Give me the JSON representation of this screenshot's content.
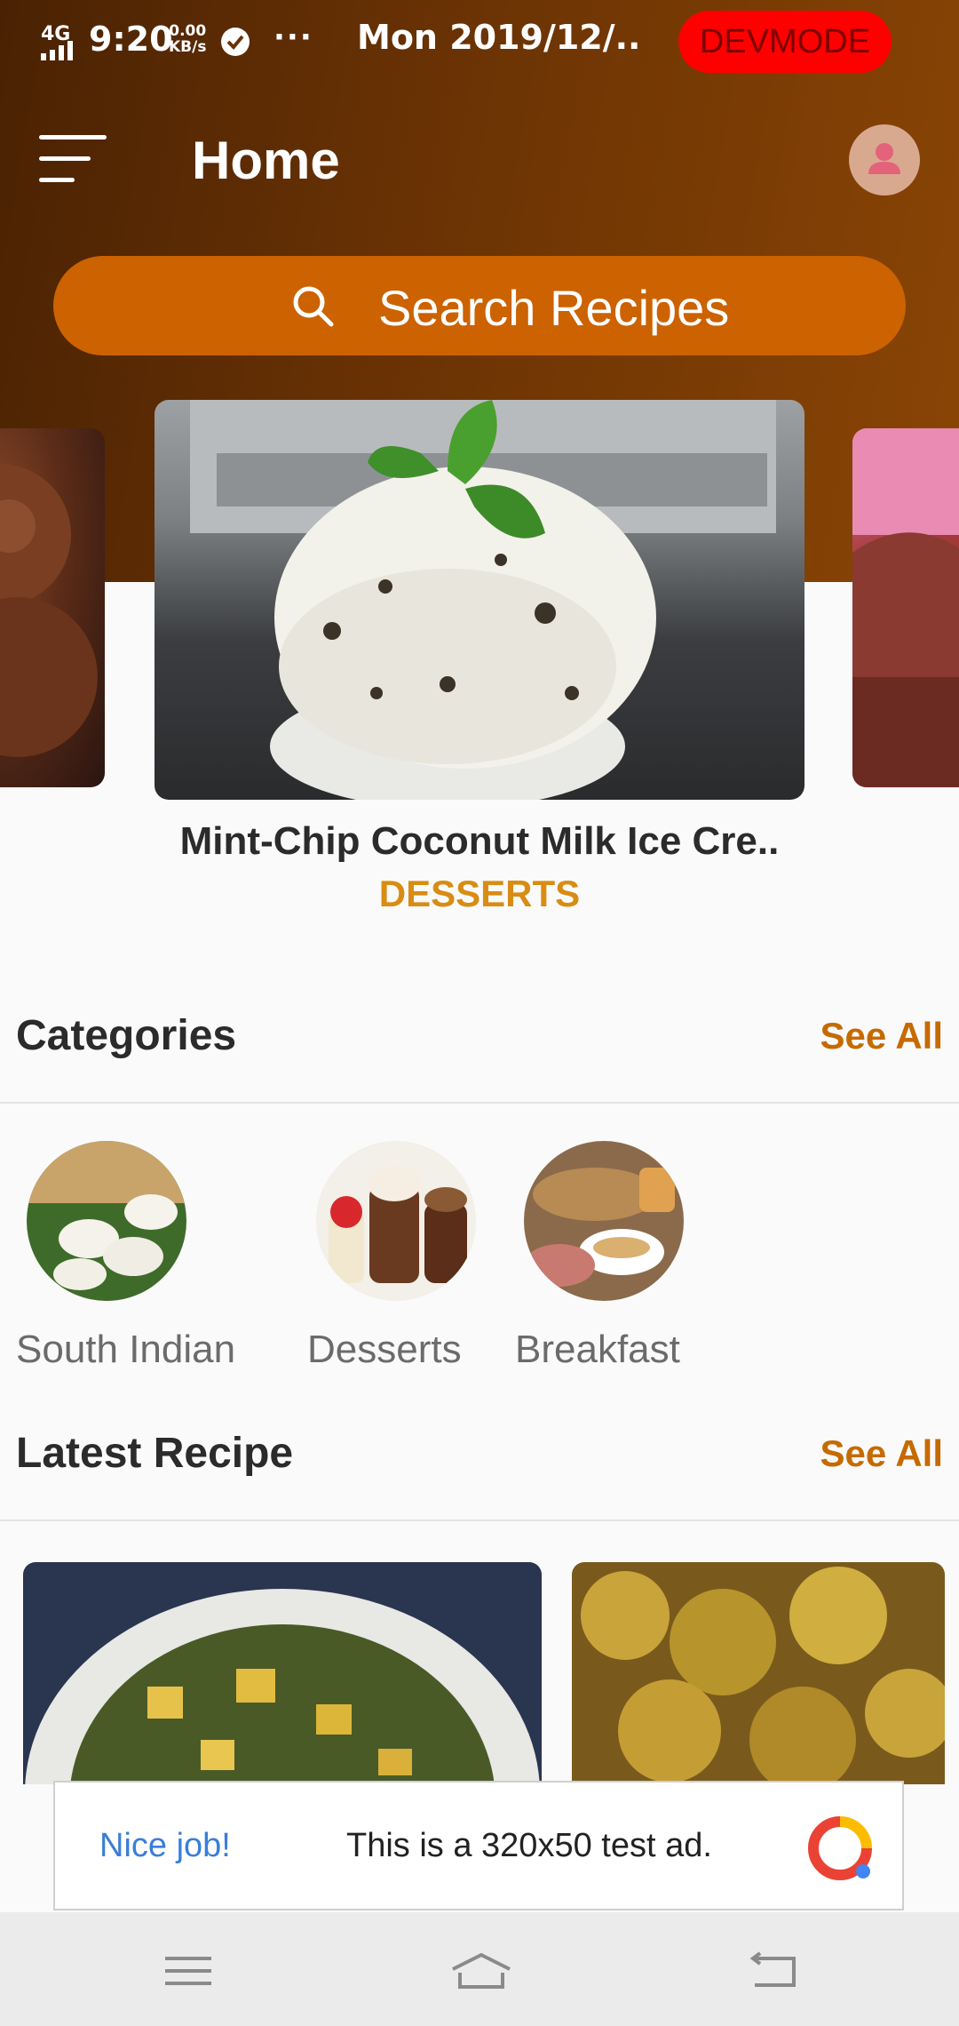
{
  "status_bar": {
    "network": "4G",
    "time": "9:20",
    "speed_value": "0.00",
    "speed_unit": "KB/s",
    "more": "···",
    "date": "Mon 2019/12/..",
    "devmode": "DEVMODE"
  },
  "header": {
    "title": "Home",
    "menu_icon": "hamburger-menu-icon",
    "avatar_icon": "user-avatar-icon"
  },
  "search": {
    "placeholder": "Search Recipes",
    "icon": "search-icon"
  },
  "carousel": {
    "active": {
      "title": "Mint-Chip Coconut Milk Ice Cre..",
      "category": "DESSERTS"
    }
  },
  "categories": {
    "title": "Categories",
    "see_all": "See All",
    "items": [
      {
        "label": "South Indian"
      },
      {
        "label": "Desserts"
      },
      {
        "label": "Breakfast"
      }
    ]
  },
  "latest": {
    "title": "Latest Recipe",
    "see_all": "See All"
  },
  "ad": {
    "nice": "Nice job!",
    "message": "This is a 320x50 test ad."
  },
  "colors": {
    "accent": "#cc6200",
    "category_text": "#d98c14",
    "see_all": "#c66a00",
    "devmode": "#ff0000"
  }
}
